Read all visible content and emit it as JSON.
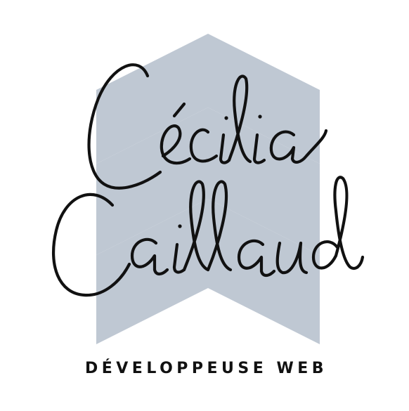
{
  "logo": {
    "name_line1": "Cécilia",
    "name_line2": "Caillaud",
    "tagline": "DÉVELOPPEUSE WEB"
  },
  "colors": {
    "background": "#ffffff",
    "chevrons": "#bfc8d3",
    "ink": "#111111"
  }
}
